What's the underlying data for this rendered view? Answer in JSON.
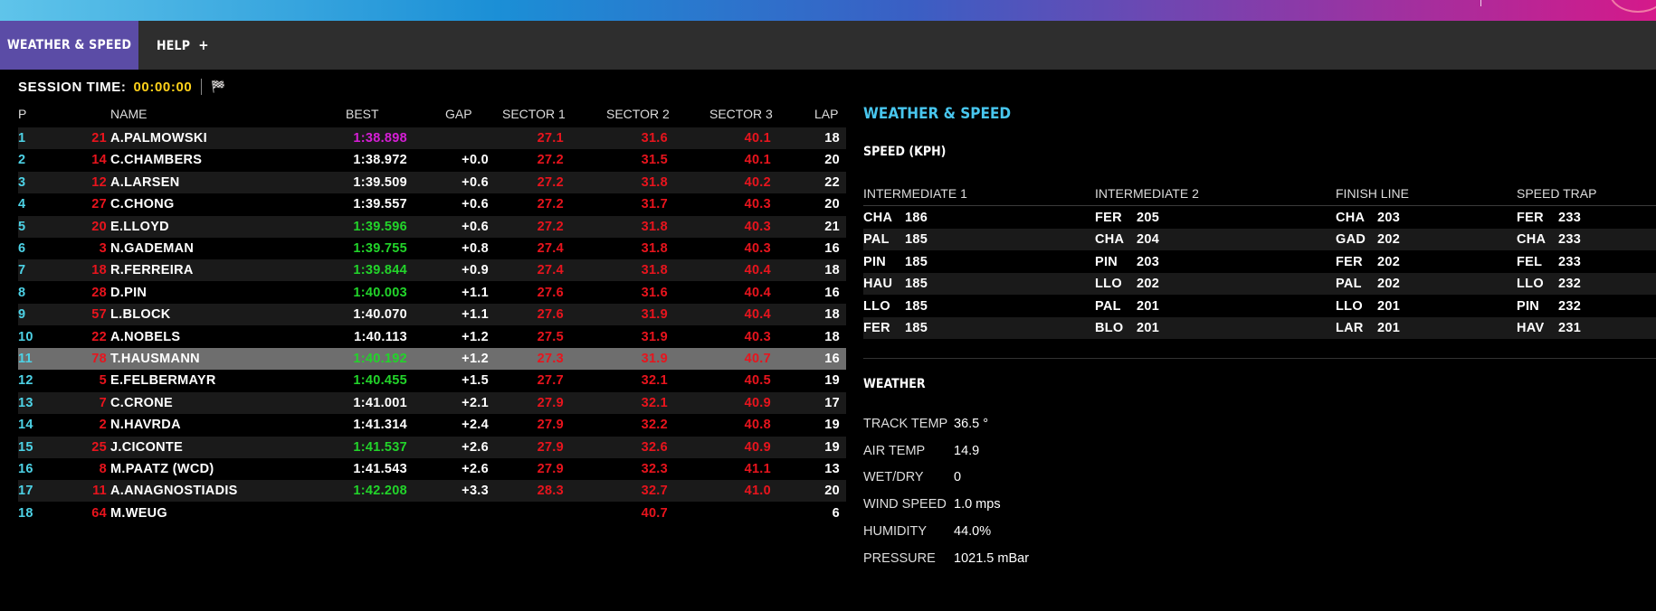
{
  "tabs": {
    "active": "WEATHER & SPEED",
    "help": "HELP",
    "help_plus": "+"
  },
  "session": {
    "label": "SESSION TIME:",
    "time": "00:00:00",
    "flag_icon": "checkered-flag-icon",
    "flag_glyph": "🏁"
  },
  "timing": {
    "headers": {
      "p": "P",
      "name": "NAME",
      "best": "BEST",
      "gap": "GAP",
      "s1": "SECTOR 1",
      "s2": "SECTOR 2",
      "s3": "SECTOR 3",
      "lap": "LAP"
    },
    "rows": [
      {
        "p": "1",
        "num": "21",
        "name": "A.PALMOWSKI",
        "best": "1:38.898",
        "best_color": "purple",
        "gap": "",
        "s1": "27.1",
        "s2": "31.6",
        "s3": "40.1",
        "lap": "18"
      },
      {
        "p": "2",
        "num": "14",
        "name": "C.CHAMBERS",
        "best": "1:38.972",
        "best_color": "white",
        "gap": "+0.0",
        "s1": "27.2",
        "s2": "31.5",
        "s3": "40.1",
        "lap": "20"
      },
      {
        "p": "3",
        "num": "12",
        "name": "A.LARSEN",
        "best": "1:39.509",
        "best_color": "white",
        "gap": "+0.6",
        "s1": "27.2",
        "s2": "31.8",
        "s3": "40.2",
        "lap": "22"
      },
      {
        "p": "4",
        "num": "27",
        "name": "C.CHONG",
        "best": "1:39.557",
        "best_color": "white",
        "gap": "+0.6",
        "s1": "27.2",
        "s2": "31.7",
        "s3": "40.3",
        "lap": "20"
      },
      {
        "p": "5",
        "num": "20",
        "name": "E.LLOYD",
        "best": "1:39.596",
        "best_color": "green",
        "gap": "+0.6",
        "s1": "27.2",
        "s2": "31.8",
        "s3": "40.3",
        "lap": "21"
      },
      {
        "p": "6",
        "num": "3",
        "name": "N.GADEMAN",
        "best": "1:39.755",
        "best_color": "green",
        "gap": "+0.8",
        "s1": "27.4",
        "s2": "31.8",
        "s3": "40.3",
        "lap": "16"
      },
      {
        "p": "7",
        "num": "18",
        "name": "R.FERREIRA",
        "best": "1:39.844",
        "best_color": "green",
        "gap": "+0.9",
        "s1": "27.4",
        "s2": "31.8",
        "s3": "40.4",
        "lap": "18"
      },
      {
        "p": "8",
        "num": "28",
        "name": "D.PIN",
        "best": "1:40.003",
        "best_color": "green",
        "gap": "+1.1",
        "s1": "27.6",
        "s2": "31.6",
        "s3": "40.4",
        "lap": "16"
      },
      {
        "p": "9",
        "num": "57",
        "name": "L.BLOCK",
        "best": "1:40.070",
        "best_color": "white",
        "gap": "+1.1",
        "s1": "27.6",
        "s2": "31.9",
        "s3": "40.4",
        "lap": "18"
      },
      {
        "p": "10",
        "num": "22",
        "name": "A.NOBELS",
        "best": "1:40.113",
        "best_color": "white",
        "gap": "+1.2",
        "s1": "27.5",
        "s2": "31.9",
        "s3": "40.3",
        "lap": "18"
      },
      {
        "p": "11",
        "num": "78",
        "name": "T.HAUSMANN",
        "best": "1:40.192",
        "best_color": "green",
        "gap": "+1.2",
        "s1": "27.3",
        "s2": "31.9",
        "s3": "40.7",
        "lap": "16",
        "highlight": true
      },
      {
        "p": "12",
        "num": "5",
        "name": "E.FELBERMAYR",
        "best": "1:40.455",
        "best_color": "green",
        "gap": "+1.5",
        "s1": "27.7",
        "s2": "32.1",
        "s3": "40.5",
        "lap": "19"
      },
      {
        "p": "13",
        "num": "7",
        "name": "C.CRONE",
        "best": "1:41.001",
        "best_color": "white",
        "gap": "+2.1",
        "s1": "27.9",
        "s2": "32.1",
        "s3": "40.9",
        "lap": "17"
      },
      {
        "p": "14",
        "num": "2",
        "name": "N.HAVRDA",
        "best": "1:41.314",
        "best_color": "white",
        "gap": "+2.4",
        "s1": "27.9",
        "s2": "32.2",
        "s3": "40.8",
        "lap": "19"
      },
      {
        "p": "15",
        "num": "25",
        "name": "J.CICONTE",
        "best": "1:41.537",
        "best_color": "green",
        "gap": "+2.6",
        "s1": "27.9",
        "s2": "32.6",
        "s3": "40.9",
        "lap": "19"
      },
      {
        "p": "16",
        "num": "8",
        "name": "M.PAATZ (WCD)",
        "best": "1:41.543",
        "best_color": "white",
        "gap": "+2.6",
        "s1": "27.9",
        "s2": "32.3",
        "s3": "41.1",
        "lap": "13"
      },
      {
        "p": "17",
        "num": "11",
        "name": "A.ANAGNOSTIADIS",
        "best": "1:42.208",
        "best_color": "green",
        "gap": "+3.3",
        "s1": "28.3",
        "s2": "32.7",
        "s3": "41.0",
        "lap": "20"
      },
      {
        "p": "18",
        "num": "64",
        "name": "M.WEUG",
        "best": "",
        "best_color": "white",
        "gap": "",
        "s1": "",
        "s2": "40.7",
        "s3": "",
        "lap": "6"
      }
    ]
  },
  "panel": {
    "title": "WEATHER & SPEED",
    "speed_title": "SPEED (KPH)",
    "speed_headers": [
      "INTERMEDIATE 1",
      "INTERMEDIATE 2",
      "FINISH LINE",
      "SPEED TRAP"
    ],
    "speed_rows": [
      [
        [
          "CHA",
          "186"
        ],
        [
          "FER",
          "205"
        ],
        [
          "CHA",
          "203"
        ],
        [
          "FER",
          "233"
        ]
      ],
      [
        [
          "PAL",
          "185"
        ],
        [
          "CHA",
          "204"
        ],
        [
          "GAD",
          "202"
        ],
        [
          "CHA",
          "233"
        ]
      ],
      [
        [
          "PIN",
          "185"
        ],
        [
          "PIN",
          "203"
        ],
        [
          "FER",
          "202"
        ],
        [
          "FEL",
          "233"
        ]
      ],
      [
        [
          "HAU",
          "185"
        ],
        [
          "LLO",
          "202"
        ],
        [
          "PAL",
          "202"
        ],
        [
          "LLO",
          "232"
        ]
      ],
      [
        [
          "LLO",
          "185"
        ],
        [
          "PAL",
          "201"
        ],
        [
          "LLO",
          "201"
        ],
        [
          "PIN",
          "232"
        ]
      ],
      [
        [
          "FER",
          "185"
        ],
        [
          "BLO",
          "201"
        ],
        [
          "LAR",
          "201"
        ],
        [
          "HAV",
          "231"
        ]
      ]
    ],
    "weather_title": "WEATHER",
    "weather": [
      {
        "label": "TRACK TEMP",
        "value": "36.5 °"
      },
      {
        "label": "AIR TEMP",
        "value": "14.9"
      },
      {
        "label": "WET/DRY",
        "value": "0"
      },
      {
        "label": "WIND SPEED",
        "value": "1.0 mps"
      },
      {
        "label": "HUMIDITY",
        "value": "44.0%"
      },
      {
        "label": "PRESSURE",
        "value": "1021.5 mBar"
      }
    ]
  },
  "colors": {
    "purple": "#d61ed6",
    "green": "#22d42a",
    "red": "#e8141d",
    "cyan": "#4dd2e6",
    "yellow": "#ffd21a",
    "accent": "#5b4ca6",
    "title_blue": "#48c6ee"
  }
}
